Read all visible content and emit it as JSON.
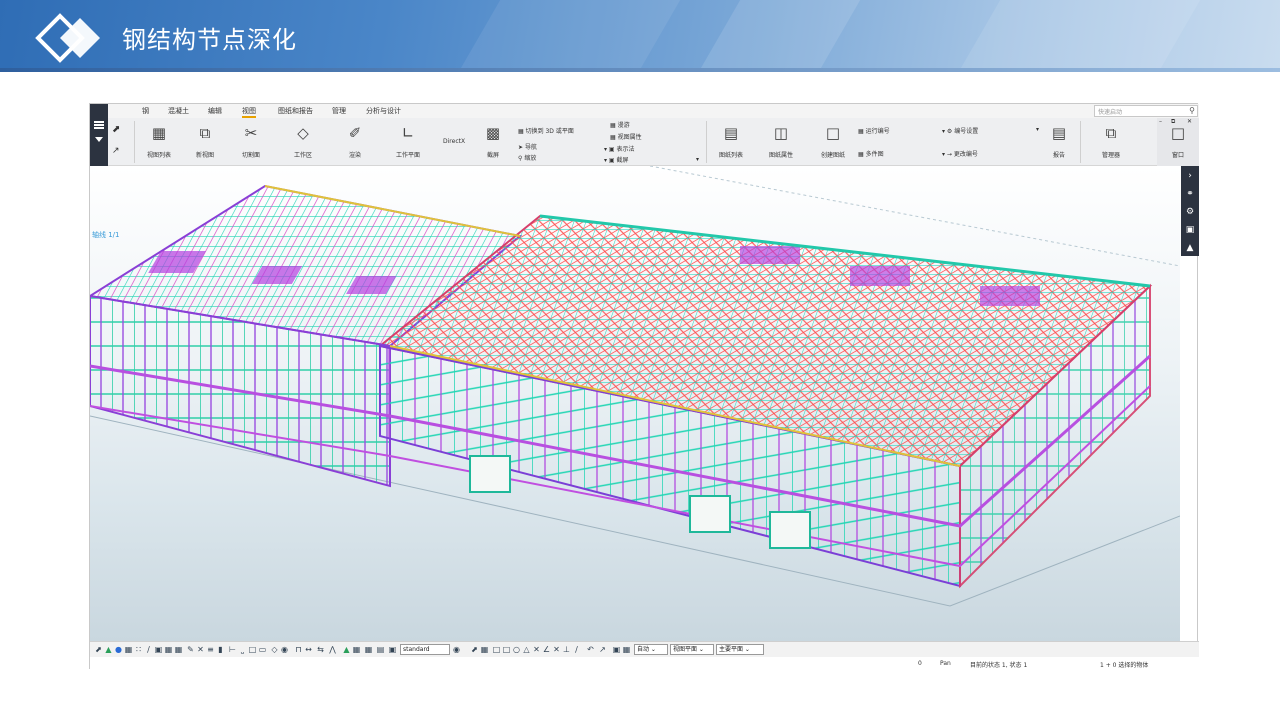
{
  "slide": {
    "title": "钢结构节点深化",
    "colors": {
      "banner_start": "#2f6db5",
      "banner_end": "#c9dcef"
    }
  },
  "app": {
    "menu_tabs": [
      "钢",
      "混凝土",
      "编辑",
      "视图",
      "图纸和报告",
      "管理",
      "分析与设计"
    ],
    "active_tab": "视图",
    "search_placeholder": "快速启动",
    "ribbon": {
      "view_list": "视图列表",
      "new_view": "新视图",
      "clip_plane": "切割面",
      "work_area": "工作区",
      "render": "渲染",
      "work_plane": "工作平面",
      "directx": "DirectX",
      "screenshot": "截屏",
      "switch_3d": "切换到 3D 或平面",
      "navigate": "导航",
      "zoom": "缩放",
      "roam": "漫游",
      "view_properties": "视图属性",
      "display": "表示法",
      "capture": "截屏",
      "drawing_list": "图纸列表",
      "drawing_properties": "图纸属性",
      "create_drawing": "创建图纸",
      "run_numbering": "运行编号",
      "multi_drawing": "多件图",
      "numbering_settings": "编号设置",
      "change_numbering": "更改编号",
      "report": "报告",
      "organizer": "管理器",
      "window": "窗口"
    },
    "icons": {
      "hamburger": "menu-icon",
      "search": "search-icon",
      "right_tools": [
        "chevron-right-icon",
        "link-icon",
        "gear-icon",
        "cube-icon",
        "layers-icon"
      ]
    },
    "toolbar": {
      "filter_value": "standard",
      "snap_select_1": "自动",
      "snap_select_2": "视图平面",
      "snap_select_3": "主要平面"
    },
    "status": {
      "count": "0",
      "mode": "Pan",
      "state": "目前的状态 1, 状态 1",
      "selection": "1 + 0 选择的物体"
    },
    "viewport_label": "轴线 1/1"
  }
}
